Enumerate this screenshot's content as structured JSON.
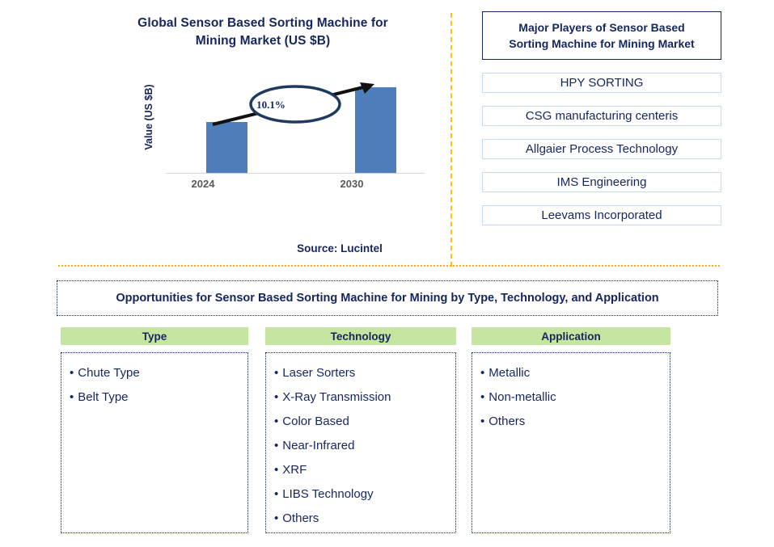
{
  "chart_panel": {
    "title": "Global Sensor Based Sorting Machine for Mining Market (US $B)",
    "title_line1": "Global Sensor Based Sorting Machine for",
    "title_line2": "Mining Market (US $B)",
    "source_note": "Source: Lucintel"
  },
  "chart_data": {
    "type": "bar",
    "title": "Global Sensor Based Sorting Machine for Mining Market (US $B)",
    "xlabel": "",
    "ylabel": "Value (US $B)",
    "categories": [
      "2024",
      "2030"
    ],
    "values": [
      0.59,
      1.0
    ],
    "value_unit": "relative bar height (unlabeled axis)",
    "ylim": [
      0,
      1.15
    ],
    "grid": false,
    "legend": null,
    "annotations": [
      {
        "type": "cagr-callout",
        "label": "10.1%",
        "from_category": "2024",
        "to_category": "2030",
        "shape": "ellipse-with-arrow"
      }
    ],
    "series_color": "#4e7fbb"
  },
  "players": {
    "header": "Major Players of Sensor Based Sorting Machine for Mining Market",
    "header_line1": "Major Players of Sensor Based",
    "header_line2": "Sorting Machine for Mining Market",
    "items": [
      {
        "name": "HPY SORTING"
      },
      {
        "name": "CSG manufacturing centeris"
      },
      {
        "name": "Allgaier Process Technology"
      },
      {
        "name": "IMS Engineering"
      },
      {
        "name": "Leevams Incorporated"
      }
    ]
  },
  "opportunities": {
    "banner": "Opportunities for Sensor Based Sorting Machine for Mining by Type, Technology, and Application",
    "segments": [
      {
        "header": "Type",
        "items": [
          "Chute Type",
          "Belt Type"
        ]
      },
      {
        "header": "Technology",
        "items": [
          "Laser Sorters",
          "X-Ray Transmission",
          "Color Based",
          "Near-Infrared",
          "XRF",
          "LIBS Technology",
          "Others"
        ]
      },
      {
        "header": "Application",
        "items": [
          "Metallic",
          "Non-metallic",
          "Others"
        ]
      }
    ]
  },
  "colors": {
    "navy_text": "#15265e",
    "bar_blue": "#4e7fbb",
    "segment_header_green": "#c6e5a0",
    "divider_gold": "#ffc20e",
    "player_border_blue": "#c5dcef",
    "axis_gray": "#595959"
  },
  "bullet": "•"
}
